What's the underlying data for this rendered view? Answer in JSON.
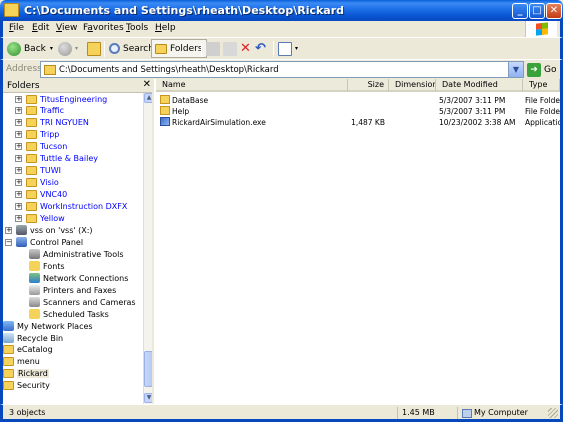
{
  "window": {
    "title": "C:\\Documents and Settings\\rheath\\Desktop\\Rickard",
    "minimize_symbol": "_",
    "maximize_symbol": "□",
    "close_symbol": "✕"
  },
  "menu": {
    "items": [
      {
        "key": "F",
        "rest": "ile"
      },
      {
        "key": "E",
        "rest": "dit"
      },
      {
        "key": "V",
        "rest": "iew"
      },
      {
        "key": "",
        "pre": "F",
        "key2": "a",
        "rest": "vorites"
      },
      {
        "key": "T",
        "rest": "ools"
      },
      {
        "key": "H",
        "rest": "elp"
      }
    ]
  },
  "toolbar": {
    "back_label": "Back",
    "search_label": "Search",
    "folders_label": "Folders",
    "back_icon": "back-arrow-icon",
    "forward_icon": "forward-arrow-icon",
    "up_icon": "up-folder-icon",
    "search_icon": "magnifier-icon",
    "folders_icon": "folders-icon",
    "move_icon": "move-to-icon",
    "copy_icon": "copy-to-icon",
    "delete_icon": "delete-icon",
    "undo_icon": "undo-icon",
    "views_icon": "views-icon"
  },
  "address": {
    "label": "Address",
    "value": "C:\\Documents and Settings\\rheath\\Desktop\\Rickard",
    "go_label": "Go"
  },
  "folders_pane": {
    "title": "Folders",
    "close_symbol": "✕",
    "items": [
      {
        "label": "TitusEngineering",
        "type": "folder",
        "expander": "+",
        "color": "blue"
      },
      {
        "label": "Traffic",
        "type": "folder",
        "expander": "+",
        "color": "blue"
      },
      {
        "label": "TRI NGYUEN",
        "type": "folder",
        "expander": "+",
        "color": "blue"
      },
      {
        "label": "Tripp",
        "type": "folder",
        "expander": "+",
        "color": "blue"
      },
      {
        "label": "Tucson",
        "type": "folder",
        "expander": "+",
        "color": "blue"
      },
      {
        "label": "Tuttle & Bailey",
        "type": "folder",
        "expander": "+",
        "color": "blue"
      },
      {
        "label": "TUWI",
        "type": "folder",
        "expander": "+",
        "color": "blue"
      },
      {
        "label": "Visio",
        "type": "folder",
        "expander": "+",
        "color": "blue"
      },
      {
        "label": "VNC40",
        "type": "folder",
        "expander": "+",
        "color": "blue"
      },
      {
        "label": "WorkInstruction DXFX",
        "type": "folder",
        "expander": "+",
        "color": "blue"
      },
      {
        "label": "Yellow",
        "type": "folder",
        "expander": "+",
        "color": "blue"
      },
      {
        "label": "vss on 'vss' (X:)",
        "type": "network-drive",
        "expander": "+",
        "color": "black"
      },
      {
        "label": "Control Panel",
        "type": "control-panel",
        "expander": "−",
        "color": "black"
      },
      {
        "label": "Administrative Tools",
        "type": "admin-tools",
        "expander": "",
        "color": "black"
      },
      {
        "label": "Fonts",
        "type": "fonts",
        "expander": "",
        "color": "black"
      },
      {
        "label": "Network Connections",
        "type": "network",
        "expander": "",
        "color": "black"
      },
      {
        "label": "Printers and Faxes",
        "type": "printer",
        "expander": "",
        "color": "black"
      },
      {
        "label": "Scanners and Cameras",
        "type": "scanner",
        "expander": "",
        "color": "black"
      },
      {
        "label": "Scheduled Tasks",
        "type": "tasks",
        "expander": "",
        "color": "black"
      },
      {
        "label": "My Network Places",
        "type": "network-places",
        "expander": "",
        "color": "black"
      },
      {
        "label": "Recycle Bin",
        "type": "recycle-bin",
        "expander": "",
        "color": "black"
      },
      {
        "label": "eCatalog",
        "type": "folder",
        "expander": "",
        "color": "black"
      },
      {
        "label": "menu",
        "type": "folder",
        "expander": "",
        "color": "black"
      },
      {
        "label": "Rickard",
        "type": "folder",
        "expander": "",
        "color": "black",
        "selected": true
      },
      {
        "label": "Security",
        "type": "folder",
        "expander": "",
        "color": "black"
      }
    ]
  },
  "file_list": {
    "columns": [
      "Name",
      "Size",
      "Dimensions",
      "Date Modified",
      "Type"
    ],
    "rows": [
      {
        "name": "DataBase",
        "size": "",
        "dimensions": "",
        "date": "5/3/2007 3:11 PM",
        "type": "File Folder",
        "icon": "folder-icon"
      },
      {
        "name": "Help",
        "size": "",
        "dimensions": "",
        "date": "5/3/2007 3:11 PM",
        "type": "File Folder",
        "icon": "folder-icon"
      },
      {
        "name": "RickardAirSimulation.exe",
        "size": "1,487 KB",
        "dimensions": "",
        "date": "10/23/2002 3:38 AM",
        "type": "Application",
        "icon": "application-icon"
      }
    ]
  },
  "status": {
    "objects": "3 objects",
    "size": "1.45 MB",
    "location": "My Computer"
  },
  "colors": {
    "titlebar": "#0a5fd8",
    "link_blue": "#0000ff",
    "folder_yellow": "#f5d259",
    "chrome": "#ece9d8"
  }
}
